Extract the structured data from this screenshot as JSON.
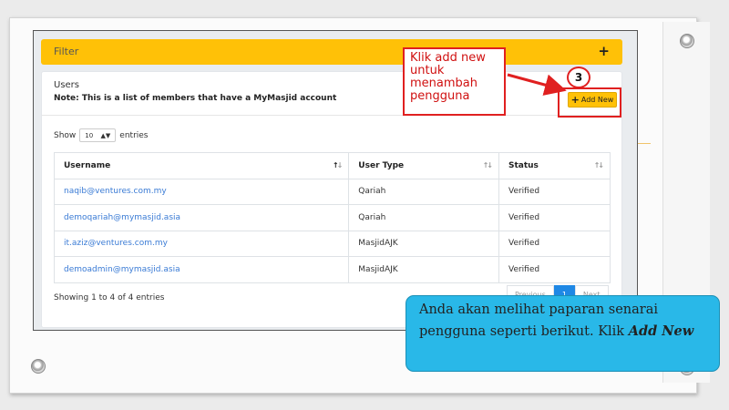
{
  "filter": {
    "label": "Filter",
    "toggle": "+"
  },
  "users_card": {
    "title": "Users",
    "note": "Note: This is a list of members that have a MyMasjid account",
    "add_new_label": "Add New",
    "add_new_icon": "+"
  },
  "entries": {
    "show_label": "Show",
    "page_size": "10",
    "entries_label": "entries"
  },
  "table": {
    "columns": [
      "Username",
      "User Type",
      "Status"
    ],
    "rows": [
      {
        "username": "naqib@ventures.com.my",
        "user_type": "Qariah",
        "status": "Verified"
      },
      {
        "username": "demoqariah@mymasjid.asia",
        "user_type": "Qariah",
        "status": "Verified"
      },
      {
        "username": "it.aziz@ventures.com.my",
        "user_type": "MasjidAJK",
        "status": "Verified"
      },
      {
        "username": "demoadmin@mymasjid.asia",
        "user_type": "MasjidAJK",
        "status": "Verified"
      }
    ]
  },
  "footer": {
    "showing": "Showing 1 to 4 of 4 entries",
    "pagination": [
      "Previous",
      "1",
      "Next"
    ]
  },
  "annotation": {
    "callout_lines": [
      "Klik add new",
      "untuk",
      "menambah",
      "pengguna"
    ],
    "step_number": "3",
    "instruction_prefix": "Anda akan melihat paparan senarai pengguna seperti berikut. Klik ",
    "instruction_emphasis": "Add New"
  },
  "colors": {
    "accent": "#ffc107",
    "link": "#3a7bd5",
    "annotation": "#e02020",
    "info_box": "#29b8e8"
  }
}
